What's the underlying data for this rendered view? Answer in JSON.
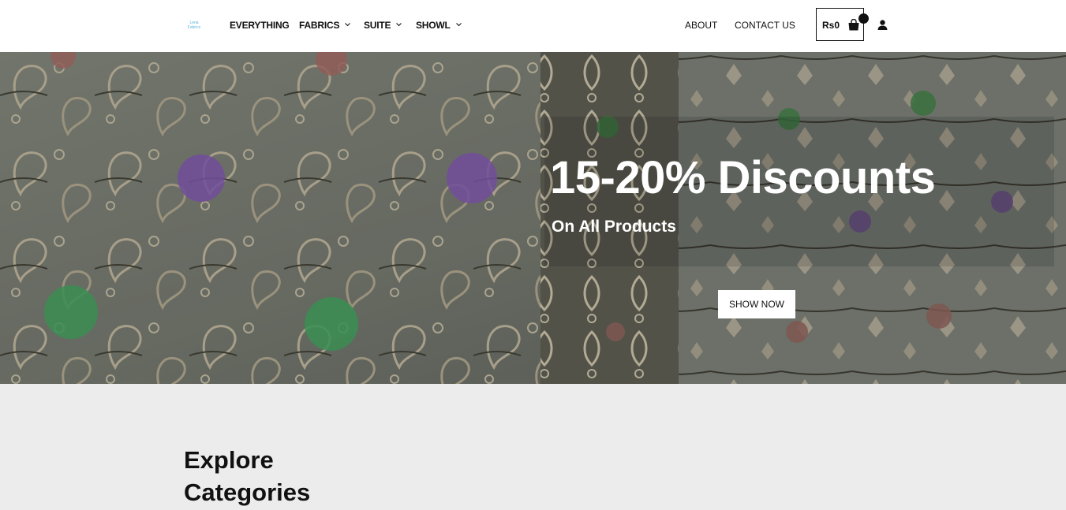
{
  "header": {
    "logo_text": "Lena Fabrics",
    "nav": [
      {
        "label": "EVERYTHING",
        "has_dropdown": false
      },
      {
        "label": "FABRICS",
        "has_dropdown": true
      },
      {
        "label": "SUITE",
        "has_dropdown": true
      },
      {
        "label": "SHOWL",
        "has_dropdown": true
      }
    ],
    "links": {
      "about": "ABOUT",
      "contact": "CONTACT US"
    },
    "cart": {
      "total": "Rs0",
      "icon": "shopping-bag-icon",
      "badge_icon": "cart-badge"
    },
    "account_icon": "user-icon"
  },
  "hero": {
    "title": "15-20% Discounts",
    "subtitle": "On All Products",
    "button_label": "SHOW NOW"
  },
  "section": {
    "title": "Explore Categories"
  },
  "colors": {
    "header_bg": "#ffffff",
    "page_bg": "#ececec",
    "text": "#111111",
    "hero_text": "#ffffff"
  }
}
